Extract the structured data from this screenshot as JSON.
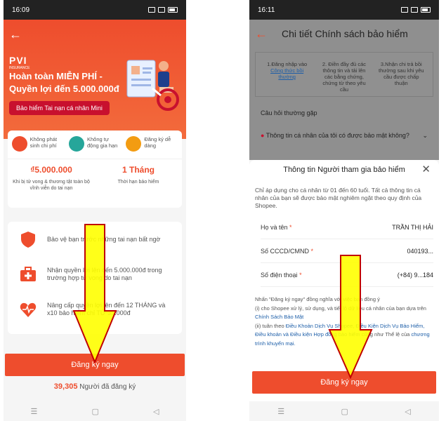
{
  "left": {
    "status": {
      "time": "16:09"
    },
    "hero": {
      "brand": "PVI",
      "brand_sub": "INSURANCE",
      "title": "Hoàn toàn MIỄN PHÍ - Quyền lợi đến 5.000.000đ",
      "product_pill": "Bảo hiểm Tai nạn cá nhân Mini"
    },
    "benefits": [
      {
        "label": "Không phát sinh chi phí",
        "icon": "no-fee-icon"
      },
      {
        "label": "Không tự động gia hạn",
        "icon": "no-renew-icon"
      },
      {
        "label": "Đăng ký dễ dàng",
        "icon": "easy-register-icon"
      }
    ],
    "stats": [
      {
        "value": "₫5.000.000",
        "label": "Khi bị tử vong & thương tật toàn bộ vĩnh viễn do tai nạn"
      },
      {
        "value": "1 Tháng",
        "label": "Thời hạn bảo hiểm"
      }
    ],
    "features": [
      {
        "text": "Bảo vệ bạn trước những tai nạn bất ngờ",
        "icon": "shield-icon"
      },
      {
        "text": "Nhận quyền lợi lên đến 5.000.000đ trong trường hợp tử vong do tai nạn",
        "icon": "medical-kit-icon"
      },
      {
        "text": "Nâng cấp quyền lợi lên đến 12 THÁNG và x10 bảo hiểm chỉ TỪ 35.000đ",
        "icon": "heart-pulse-icon"
      }
    ],
    "cta": "Đăng ký ngay",
    "registered": {
      "count": "39,305",
      "label": "Người đã đăng ký"
    }
  },
  "right": {
    "status": {
      "time": "16:11"
    },
    "header_title": "Chi tiết Chính sách bảo hiểm",
    "steps": [
      {
        "text": "1.Đăng nhập vào",
        "link": "Công thức bồi thường"
      },
      {
        "text": "2. Điền đầy đủ các thông tin và tải lên các bằng chứng, chứng từ theo yêu cầu",
        "link": ""
      },
      {
        "text": "3.Nhận chi trả bồi thường sau khi yêu cầu được chấp thuận",
        "link": ""
      }
    ],
    "faq_label": "Câu hỏi thường gặp",
    "faq_question": "Thông tin cá nhân của tôi có được bảo mật không?",
    "sheet": {
      "title": "Thông tin Người tham gia bảo hiểm",
      "description": "Chỉ áp dụng cho cá nhân từ 01 đến 60 tuổi. Tất cả thông tin cá nhân của bạn sẽ được bảo mật nghiêm ngặt theo quy định của Shopee.",
      "fields": [
        {
          "label": "Họ và tên",
          "value": "TRẦN THỊ HẢI"
        },
        {
          "label": "Số CCCD/CMND",
          "value": "040193..."
        },
        {
          "label": "Số điện thoại",
          "value": "(+84) 9...184"
        }
      ],
      "legal": {
        "l1": "Nhấn \"Đăng ký ngay\" đồng nghĩa với việc bạn đồng ý",
        "l2": "(i) cho Shopee xử lý, sử dụng, và tiết lộ dữ liệu cá nhân của bạn dựa trên ",
        "l2_link": "Chính Sách Bảo Mật",
        "l3": "(ii) tuân theo ",
        "l3_link": "Điều Khoản Dịch Vụ Shopee, Điều Kiện Dịch Vụ Bảo Hiểm, Điều khoản và Điều kiện Hợp đồng bảo hiểm",
        "l3_tail": " cũng như Thể lệ của ",
        "l3_link2": "chương trình khuyến mại."
      },
      "cta": "Đăng ký ngay"
    }
  },
  "colors": {
    "accent": "#ee4d2d",
    "arrow": "#ffff00",
    "arrow_outline": "#c00000"
  }
}
